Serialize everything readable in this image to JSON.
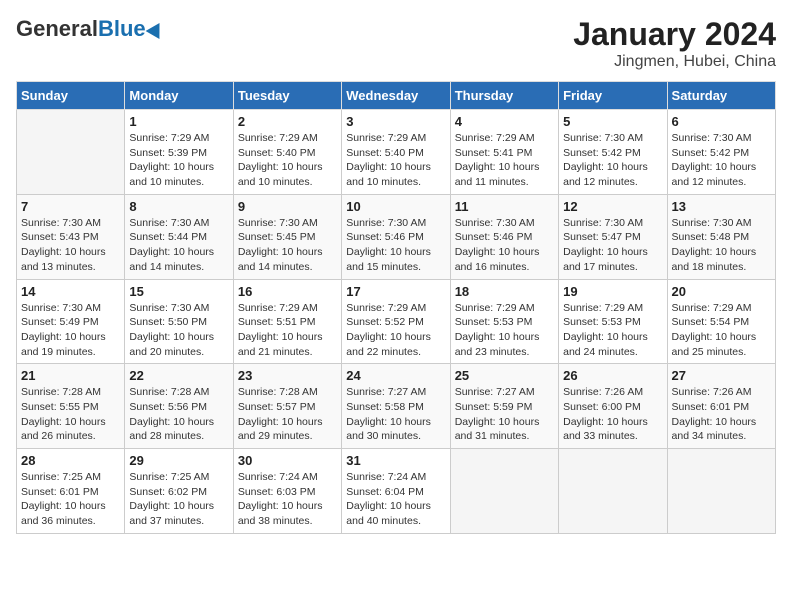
{
  "header": {
    "logo_general": "General",
    "logo_blue": "Blue",
    "title": "January 2024",
    "subtitle": "Jingmen, Hubei, China"
  },
  "weekdays": [
    "Sunday",
    "Monday",
    "Tuesday",
    "Wednesday",
    "Thursday",
    "Friday",
    "Saturday"
  ],
  "weeks": [
    [
      {
        "day": "",
        "info": ""
      },
      {
        "day": "1",
        "info": "Sunrise: 7:29 AM\nSunset: 5:39 PM\nDaylight: 10 hours and 10 minutes."
      },
      {
        "day": "2",
        "info": "Sunrise: 7:29 AM\nSunset: 5:40 PM\nDaylight: 10 hours and 10 minutes."
      },
      {
        "day": "3",
        "info": "Sunrise: 7:29 AM\nSunset: 5:40 PM\nDaylight: 10 hours and 10 minutes."
      },
      {
        "day": "4",
        "info": "Sunrise: 7:29 AM\nSunset: 5:41 PM\nDaylight: 10 hours and 11 minutes."
      },
      {
        "day": "5",
        "info": "Sunrise: 7:30 AM\nSunset: 5:42 PM\nDaylight: 10 hours and 12 minutes."
      },
      {
        "day": "6",
        "info": "Sunrise: 7:30 AM\nSunset: 5:42 PM\nDaylight: 10 hours and 12 minutes."
      }
    ],
    [
      {
        "day": "7",
        "info": "Sunrise: 7:30 AM\nSunset: 5:43 PM\nDaylight: 10 hours and 13 minutes."
      },
      {
        "day": "8",
        "info": "Sunrise: 7:30 AM\nSunset: 5:44 PM\nDaylight: 10 hours and 14 minutes."
      },
      {
        "day": "9",
        "info": "Sunrise: 7:30 AM\nSunset: 5:45 PM\nDaylight: 10 hours and 14 minutes."
      },
      {
        "day": "10",
        "info": "Sunrise: 7:30 AM\nSunset: 5:46 PM\nDaylight: 10 hours and 15 minutes."
      },
      {
        "day": "11",
        "info": "Sunrise: 7:30 AM\nSunset: 5:46 PM\nDaylight: 10 hours and 16 minutes."
      },
      {
        "day": "12",
        "info": "Sunrise: 7:30 AM\nSunset: 5:47 PM\nDaylight: 10 hours and 17 minutes."
      },
      {
        "day": "13",
        "info": "Sunrise: 7:30 AM\nSunset: 5:48 PM\nDaylight: 10 hours and 18 minutes."
      }
    ],
    [
      {
        "day": "14",
        "info": "Sunrise: 7:30 AM\nSunset: 5:49 PM\nDaylight: 10 hours and 19 minutes."
      },
      {
        "day": "15",
        "info": "Sunrise: 7:30 AM\nSunset: 5:50 PM\nDaylight: 10 hours and 20 minutes."
      },
      {
        "day": "16",
        "info": "Sunrise: 7:29 AM\nSunset: 5:51 PM\nDaylight: 10 hours and 21 minutes."
      },
      {
        "day": "17",
        "info": "Sunrise: 7:29 AM\nSunset: 5:52 PM\nDaylight: 10 hours and 22 minutes."
      },
      {
        "day": "18",
        "info": "Sunrise: 7:29 AM\nSunset: 5:53 PM\nDaylight: 10 hours and 23 minutes."
      },
      {
        "day": "19",
        "info": "Sunrise: 7:29 AM\nSunset: 5:53 PM\nDaylight: 10 hours and 24 minutes."
      },
      {
        "day": "20",
        "info": "Sunrise: 7:29 AM\nSunset: 5:54 PM\nDaylight: 10 hours and 25 minutes."
      }
    ],
    [
      {
        "day": "21",
        "info": "Sunrise: 7:28 AM\nSunset: 5:55 PM\nDaylight: 10 hours and 26 minutes."
      },
      {
        "day": "22",
        "info": "Sunrise: 7:28 AM\nSunset: 5:56 PM\nDaylight: 10 hours and 28 minutes."
      },
      {
        "day": "23",
        "info": "Sunrise: 7:28 AM\nSunset: 5:57 PM\nDaylight: 10 hours and 29 minutes."
      },
      {
        "day": "24",
        "info": "Sunrise: 7:27 AM\nSunset: 5:58 PM\nDaylight: 10 hours and 30 minutes."
      },
      {
        "day": "25",
        "info": "Sunrise: 7:27 AM\nSunset: 5:59 PM\nDaylight: 10 hours and 31 minutes."
      },
      {
        "day": "26",
        "info": "Sunrise: 7:26 AM\nSunset: 6:00 PM\nDaylight: 10 hours and 33 minutes."
      },
      {
        "day": "27",
        "info": "Sunrise: 7:26 AM\nSunset: 6:01 PM\nDaylight: 10 hours and 34 minutes."
      }
    ],
    [
      {
        "day": "28",
        "info": "Sunrise: 7:25 AM\nSunset: 6:01 PM\nDaylight: 10 hours and 36 minutes."
      },
      {
        "day": "29",
        "info": "Sunrise: 7:25 AM\nSunset: 6:02 PM\nDaylight: 10 hours and 37 minutes."
      },
      {
        "day": "30",
        "info": "Sunrise: 7:24 AM\nSunset: 6:03 PM\nDaylight: 10 hours and 38 minutes."
      },
      {
        "day": "31",
        "info": "Sunrise: 7:24 AM\nSunset: 6:04 PM\nDaylight: 10 hours and 40 minutes."
      },
      {
        "day": "",
        "info": ""
      },
      {
        "day": "",
        "info": ""
      },
      {
        "day": "",
        "info": ""
      }
    ]
  ]
}
